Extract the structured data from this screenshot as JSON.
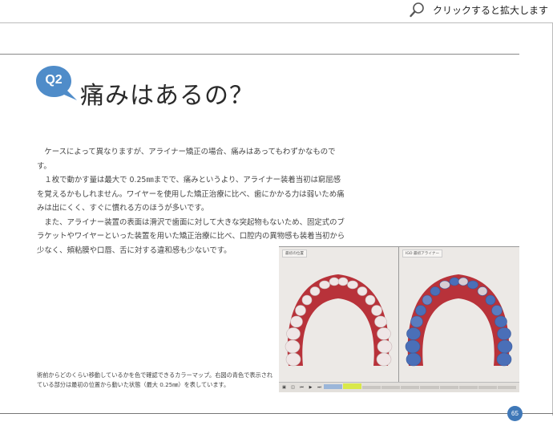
{
  "header": {
    "zoom_hint": "クリックすると拡大します",
    "zoom_icon": "magnifier-icon"
  },
  "question": {
    "badge": "Q2",
    "title": "痛みはあるの？"
  },
  "body": {
    "paragraphs": [
      "ケースによって異なりますが、アライナー矯正の場合、痛みはあってもわずかなものです。",
      "１枚で動かす量は最大で 0.25㎜までで、痛みというより、アライナー装着当初は窮屈感を覚えるかもしれません。ワイヤーを使用した矯正治療に比べ、歯にかかる力は弱いため痛みは出にくく、すぐに慣れる方のほうが多いです。",
      "また、アライナー装置の表面は滑沢で歯面に対して大きな突起物もないため、固定式のブラケットやワイヤーといった装置を用いた矯正治療に比べ、口腔内の異物感も装着当初から少なく、頬粘膜や口唇、舌に対する違和感も少ないです。"
    ]
  },
  "caption": "術前からどのくらい移動しているかを色で確認できるカラーマップ。右図の青色で表示されている部分は最初の位置から動いた状態（最大 0.25㎜）を表しています。",
  "figure": {
    "left_label": "最初の位置",
    "right_label": "IGO 最初アライナー",
    "colors": {
      "gum": "#b8323a",
      "tooth": "#efe6e6",
      "moved": "#4a6fb8",
      "background": "#ebe8e5"
    }
  },
  "page_number": "65",
  "accent_color": "#4f8cc9"
}
